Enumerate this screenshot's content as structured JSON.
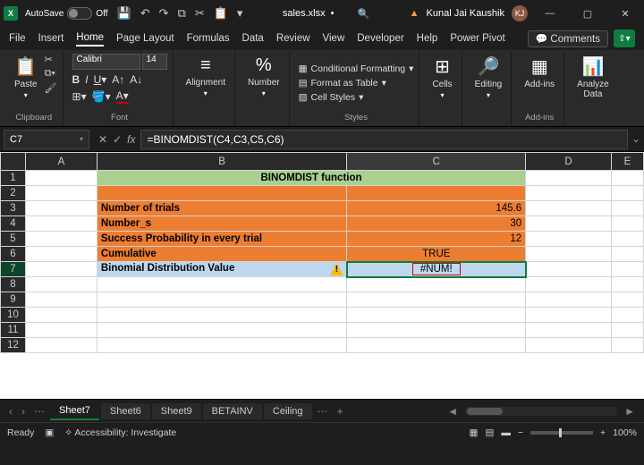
{
  "titlebar": {
    "autosave_label": "AutoSave",
    "autosave_state": "Off",
    "filename": "sales.xlsx",
    "saved_indicator": "•",
    "search_icon": "search-icon",
    "user_name": "Kunal Jai Kaushik",
    "user_initials": "KJ"
  },
  "menu": {
    "items": [
      "File",
      "Insert",
      "Home",
      "Page Layout",
      "Formulas",
      "Data",
      "Review",
      "View",
      "Developer",
      "Help",
      "Power Pivot"
    ],
    "active": "Home",
    "comments": "Comments"
  },
  "ribbon": {
    "clipboard": {
      "paste": "Paste",
      "label": "Clipboard"
    },
    "font": {
      "name": "Calibri",
      "size": "14",
      "label": "Font"
    },
    "alignment": {
      "label": "Alignment"
    },
    "number": {
      "label": "Number"
    },
    "styles": {
      "cf": "Conditional Formatting",
      "fat": "Format as Table",
      "cs": "Cell Styles",
      "label": "Styles"
    },
    "cells": {
      "label": "Cells"
    },
    "editing": {
      "label": "Editing"
    },
    "addins": {
      "btn": "Add-ins",
      "label": "Add-ins"
    },
    "analyze": {
      "btn": "Analyze\nData"
    }
  },
  "formula": {
    "namebox": "C7",
    "value": "=BINOMDIST(C4,C3,C5,C6)"
  },
  "columns": [
    "A",
    "B",
    "C",
    "D",
    "E"
  ],
  "rows": [
    "1",
    "2",
    "3",
    "4",
    "5",
    "6",
    "7",
    "8",
    "9",
    "10",
    "11",
    "12"
  ],
  "cells": {
    "title": "BINOMDIST function",
    "r3b": "Number of trials",
    "r3c": "145.6",
    "r4b": "Number_s",
    "r4c": "30",
    "r5b": "Success Probability in every trial",
    "r5c": "12",
    "r6b": "Cumulative",
    "r6c": "TRUE",
    "r7b": "Binomial Distribution Value",
    "r7c": "#NUM!"
  },
  "tabs": {
    "items": [
      "Sheet7",
      "Sheet6",
      "Sheet9",
      "BETAINV",
      "Ceiling"
    ],
    "active": "Sheet7",
    "more": "⋯",
    "add": "+"
  },
  "status": {
    "ready": "Ready",
    "acc": "Accessibility: Investigate",
    "zoom": "100%"
  }
}
